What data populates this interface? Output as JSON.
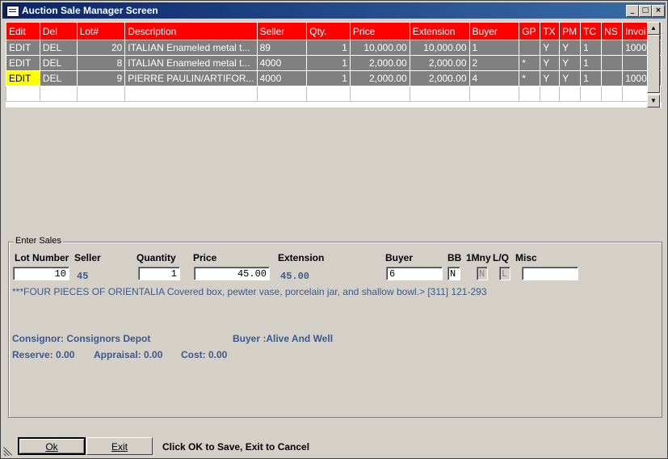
{
  "window": {
    "title": "Auction Sale Manager Screen",
    "minimize": "_",
    "maximize": "□",
    "close": "×"
  },
  "grid": {
    "headers": [
      "Edit",
      "Del",
      "Lot#",
      "Description",
      "Seller",
      "Qty.",
      "Price",
      "Extension",
      "Buyer",
      "GP",
      "TX",
      "PM",
      "TC",
      "NS",
      "Invoi"
    ],
    "rows": [
      [
        "EDIT",
        "DEL",
        "20",
        "ITALIAN Enameled metal t...",
        "89",
        "1",
        "10,000.00",
        "10,000.00",
        "1",
        "",
        "Y",
        "Y",
        "1",
        "",
        "1000"
      ],
      [
        "EDIT",
        "DEL",
        "8",
        "ITALIAN Enameled metal t...",
        "4000",
        "1",
        "2,000.00",
        "2,000.00",
        "2",
        "*",
        "Y",
        "Y",
        "1",
        "",
        ""
      ],
      [
        "EDIT",
        "DEL",
        "9",
        "PIERRE PAULIN/ARTIFOR...",
        "4000",
        "1",
        "2,000.00",
        "2,000.00",
        "4",
        "*",
        "Y",
        "Y",
        "1",
        "",
        "1000"
      ]
    ]
  },
  "enter_sales": {
    "legend": "Enter Sales",
    "labels": {
      "lot_number": "Lot Number",
      "seller": "Seller",
      "quantity": "Quantity",
      "price": "Price",
      "extension": "Extension",
      "buyer": "Buyer",
      "bb": "BB",
      "one_mny": "1Mny",
      "lq": "L/Q",
      "misc": "Misc"
    },
    "values": {
      "lot_number": "10",
      "seller": "45",
      "quantity": "1",
      "price": "45.00",
      "extension": "45.00",
      "buyer": "6",
      "bb": "N",
      "one_mny": "N",
      "lq": "L",
      "misc": ""
    },
    "description": "***FOUR PIECES OF ORIENTALIA Covered box, pewter vase, porcelain jar, and shallow bowl.> [311] 121-293",
    "consignor": "Consignor: Consignors Depot",
    "buyer_info": "Buyer :Alive And Well",
    "reserve": "Reserve: 0.00",
    "appraisal": "Appraisal: 0.00",
    "cost": "Cost: 0.00"
  },
  "buttons": {
    "ok": "Ok",
    "exit": "Exit"
  },
  "status_text": "Click OK to Save, Exit to Cancel",
  "colors": {
    "header_bg": "#ff0000",
    "row_bg": "#808080",
    "active_edit": "#ffff00",
    "info_text": "#3a5a8c"
  }
}
